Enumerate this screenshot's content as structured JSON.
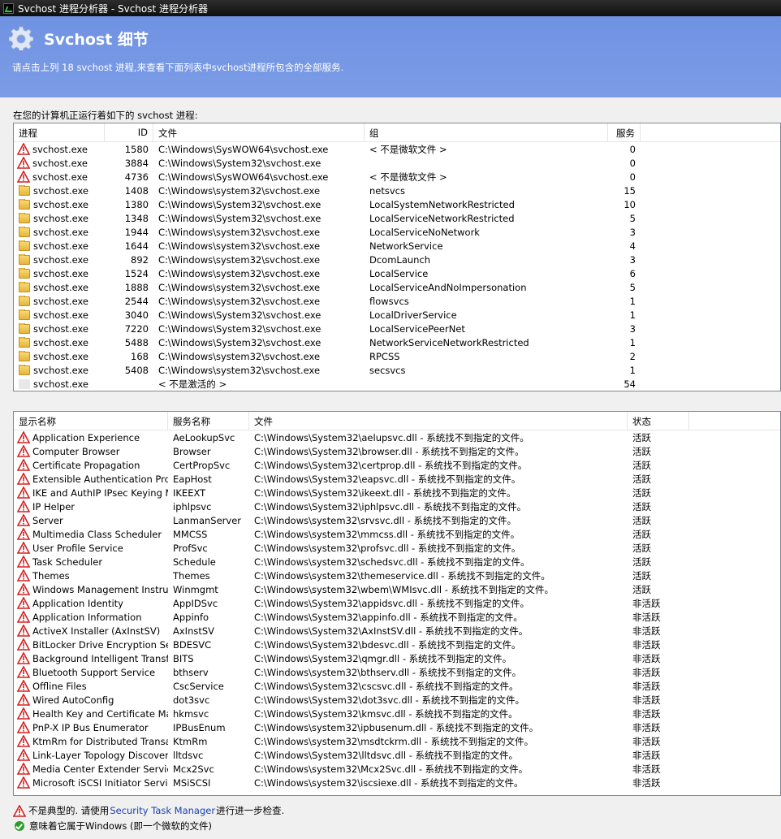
{
  "window": {
    "title": "Svchost 进程分析器 - Svchost 进程分析器"
  },
  "header": {
    "title": "Svchost 细节",
    "description": "请点击上列 18 svchost 进程,来查看下面列表中svchost进程所包含的全部服务."
  },
  "processes_label": "在您的计算机正运行着如下的 svchost 进程:",
  "process_table": {
    "columns": [
      "进程",
      "ID",
      "文件",
      "组",
      "服务"
    ],
    "rows": [
      {
        "icon": "warning-icon",
        "name": "svchost.exe",
        "id": "1580",
        "file": "C:\\Windows\\SysWOW64\\svchost.exe",
        "group": "< 不是微软文件 >",
        "count": "0"
      },
      {
        "icon": "warning-icon",
        "name": "svchost.exe",
        "id": "3884",
        "file": "C:\\Windows\\System32\\svchost.exe",
        "group": "",
        "count": "0"
      },
      {
        "icon": "warning-icon",
        "name": "svchost.exe",
        "id": "4736",
        "file": "C:\\Windows\\SysWOW64\\svchost.exe",
        "group": "< 不是微软文件 >",
        "count": "0"
      },
      {
        "icon": "folder-icon",
        "name": "svchost.exe",
        "id": "1408",
        "file": "C:\\Windows\\system32\\svchost.exe",
        "group": "netsvcs",
        "count": "15"
      },
      {
        "icon": "folder-icon",
        "name": "svchost.exe",
        "id": "1380",
        "file": "C:\\Windows\\System32\\svchost.exe",
        "group": "LocalSystemNetworkRestricted",
        "count": "10"
      },
      {
        "icon": "folder-icon",
        "name": "svchost.exe",
        "id": "1348",
        "file": "C:\\Windows\\System32\\svchost.exe",
        "group": "LocalServiceNetworkRestricted",
        "count": "5"
      },
      {
        "icon": "folder-icon",
        "name": "svchost.exe",
        "id": "1944",
        "file": "C:\\Windows\\system32\\svchost.exe",
        "group": "LocalServiceNoNetwork",
        "count": "3"
      },
      {
        "icon": "folder-icon",
        "name": "svchost.exe",
        "id": "1644",
        "file": "C:\\Windows\\system32\\svchost.exe",
        "group": "NetworkService",
        "count": "4"
      },
      {
        "icon": "folder-icon",
        "name": "svchost.exe",
        "id": "892",
        "file": "C:\\Windows\\system32\\svchost.exe",
        "group": "DcomLaunch",
        "count": "3"
      },
      {
        "icon": "folder-icon",
        "name": "svchost.exe",
        "id": "1524",
        "file": "C:\\Windows\\system32\\svchost.exe",
        "group": "LocalService",
        "count": "6"
      },
      {
        "icon": "folder-icon",
        "name": "svchost.exe",
        "id": "1888",
        "file": "C:\\Windows\\system32\\svchost.exe",
        "group": "LocalServiceAndNoImpersonation",
        "count": "5"
      },
      {
        "icon": "folder-icon",
        "name": "svchost.exe",
        "id": "2544",
        "file": "C:\\Windows\\system32\\svchost.exe",
        "group": "flowsvcs",
        "count": "1"
      },
      {
        "icon": "folder-icon",
        "name": "svchost.exe",
        "id": "3040",
        "file": "C:\\Windows\\System32\\svchost.exe",
        "group": "LocalDriverService",
        "count": "1"
      },
      {
        "icon": "folder-icon",
        "name": "svchost.exe",
        "id": "7220",
        "file": "C:\\Windows\\System32\\svchost.exe",
        "group": "LocalServicePeerNet",
        "count": "3"
      },
      {
        "icon": "folder-icon",
        "name": "svchost.exe",
        "id": "5488",
        "file": "C:\\Windows\\System32\\svchost.exe",
        "group": "NetworkServiceNetworkRestricted",
        "count": "1"
      },
      {
        "icon": "folder-icon",
        "name": "svchost.exe",
        "id": "168",
        "file": "C:\\Windows\\system32\\svchost.exe",
        "group": "RPCSS",
        "count": "2"
      },
      {
        "icon": "folder-icon",
        "name": "svchost.exe",
        "id": "5408",
        "file": "C:\\Windows\\system32\\svchost.exe",
        "group": "secsvcs",
        "count": "1"
      },
      {
        "icon": "blank-icon",
        "name": "svchost.exe",
        "id": "",
        "file": "< 不是激活的 >",
        "group": "",
        "count": "54"
      }
    ]
  },
  "service_table": {
    "columns": [
      "显示名称",
      "服务名称",
      "文件",
      "状态"
    ],
    "rows": [
      {
        "display": "Application Experience",
        "svc": "AeLookupSvc",
        "file": "C:\\Windows\\System32\\aelupsvc.dll - 系统找不到指定的文件。",
        "state": "活跃"
      },
      {
        "display": "Computer Browser",
        "svc": "Browser",
        "file": "C:\\Windows\\System32\\browser.dll - 系统找不到指定的文件。",
        "state": "活跃"
      },
      {
        "display": "Certificate Propagation",
        "svc": "CertPropSvc",
        "file": "C:\\Windows\\System32\\certprop.dll - 系统找不到指定的文件。",
        "state": "活跃"
      },
      {
        "display": "Extensible Authentication Protocol",
        "svc": "EapHost",
        "file": "C:\\Windows\\System32\\eapsvc.dll - 系统找不到指定的文件。",
        "state": "活跃"
      },
      {
        "display": "IKE and AuthIP IPsec Keying Mo...",
        "svc": "IKEEXT",
        "file": "C:\\Windows\\System32\\ikeext.dll - 系统找不到指定的文件。",
        "state": "活跃"
      },
      {
        "display": "IP Helper",
        "svc": "iphlpsvc",
        "file": "C:\\Windows\\System32\\iphlpsvc.dll - 系统找不到指定的文件。",
        "state": "活跃"
      },
      {
        "display": "Server",
        "svc": "LanmanServer",
        "file": "C:\\Windows\\system32\\srvsvc.dll - 系统找不到指定的文件。",
        "state": "活跃"
      },
      {
        "display": "Multimedia Class Scheduler",
        "svc": "MMCSS",
        "file": "C:\\Windows\\system32\\mmcss.dll - 系统找不到指定的文件。",
        "state": "活跃"
      },
      {
        "display": "User Profile Service",
        "svc": "ProfSvc",
        "file": "C:\\Windows\\system32\\profsvc.dll - 系统找不到指定的文件。",
        "state": "活跃"
      },
      {
        "display": "Task Scheduler",
        "svc": "Schedule",
        "file": "C:\\Windows\\system32\\schedsvc.dll - 系统找不到指定的文件。",
        "state": "活跃"
      },
      {
        "display": "Themes",
        "svc": "Themes",
        "file": "C:\\Windows\\system32\\themeservice.dll - 系统找不到指定的文件。",
        "state": "活跃"
      },
      {
        "display": "Windows Management Instrume...",
        "svc": "Winmgmt",
        "file": "C:\\Windows\\system32\\wbem\\WMIsvc.dll - 系统找不到指定的文件。",
        "state": "活跃"
      },
      {
        "display": "Application Identity",
        "svc": "AppIDSvc",
        "file": "C:\\Windows\\System32\\appidsvc.dll - 系统找不到指定的文件。",
        "state": "非活跃"
      },
      {
        "display": "Application Information",
        "svc": "Appinfo",
        "file": "C:\\Windows\\System32\\appinfo.dll - 系统找不到指定的文件。",
        "state": "非活跃"
      },
      {
        "display": "ActiveX Installer (AxInstSV)",
        "svc": "AxInstSV",
        "file": "C:\\Windows\\System32\\AxInstSV.dll - 系统找不到指定的文件。",
        "state": "非活跃"
      },
      {
        "display": "BitLocker Drive Encryption Service",
        "svc": "BDESVC",
        "file": "C:\\Windows\\System32\\bdesvc.dll - 系统找不到指定的文件。",
        "state": "非活跃"
      },
      {
        "display": "Background Intelligent Transfer ...",
        "svc": "BITS",
        "file": "C:\\Windows\\System32\\qmgr.dll - 系统找不到指定的文件。",
        "state": "非活跃"
      },
      {
        "display": "Bluetooth Support Service",
        "svc": "bthserv",
        "file": "C:\\Windows\\system32\\bthserv.dll - 系统找不到指定的文件。",
        "state": "非活跃"
      },
      {
        "display": "Offline Files",
        "svc": "CscService",
        "file": "C:\\Windows\\System32\\cscsvc.dll - 系统找不到指定的文件。",
        "state": "非活跃"
      },
      {
        "display": "Wired AutoConfig",
        "svc": "dot3svc",
        "file": "C:\\Windows\\System32\\dot3svc.dll - 系统找不到指定的文件。",
        "state": "非活跃"
      },
      {
        "display": "Health Key and Certificate Mana...",
        "svc": "hkmsvc",
        "file": "C:\\Windows\\System32\\kmsvc.dll - 系统找不到指定的文件。",
        "state": "非活跃"
      },
      {
        "display": "PnP-X IP Bus Enumerator",
        "svc": "IPBusEnum",
        "file": "C:\\Windows\\system32\\ipbusenum.dll - 系统找不到指定的文件。",
        "state": "非活跃"
      },
      {
        "display": "KtmRm for Distributed Transactio...",
        "svc": "KtmRm",
        "file": "C:\\Windows\\system32\\msdtckrm.dll - 系统找不到指定的文件。",
        "state": "非活跃"
      },
      {
        "display": "Link-Layer Topology Discovery ...",
        "svc": "lltdsvc",
        "file": "C:\\Windows\\System32\\lltdsvc.dll - 系统找不到指定的文件。",
        "state": "非活跃"
      },
      {
        "display": "Media Center Extender Service",
        "svc": "Mcx2Svc",
        "file": "C:\\Windows\\system32\\Mcx2Svc.dll - 系统找不到指定的文件。",
        "state": "非活跃"
      },
      {
        "display": "Microsoft iSCSI Initiator Service",
        "svc": "MSiSCSI",
        "file": "C:\\Windows\\system32\\iscsiexe.dll - 系统找不到指定的文件。",
        "state": "非活跃"
      }
    ]
  },
  "legend": {
    "warning_prefix": "不是典型的. 请使用",
    "warning_link": "Security Task Manager",
    "warning_suffix": "进行进一步检查.",
    "ok_text": "意味着它属于Windows (即一个微软的文件)"
  },
  "colors": {
    "header_bg": "#7395e3",
    "warning_red": "#d42020",
    "ok_green": "#2a9d2a",
    "link": "#1a3fb0"
  }
}
